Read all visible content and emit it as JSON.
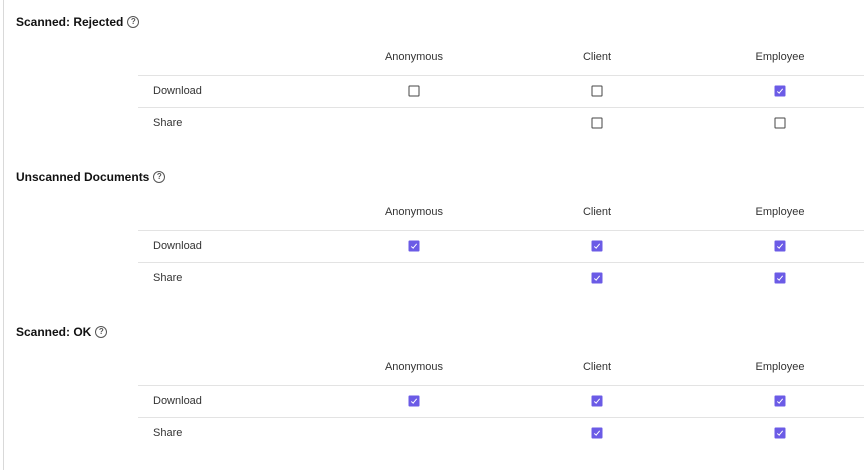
{
  "columns": [
    "Anonymous",
    "Client",
    "Employee"
  ],
  "sections": [
    {
      "title": "Scanned: Rejected",
      "rows": [
        {
          "label": "Download",
          "Anonymous": false,
          "Client": false,
          "Employee": true
        },
        {
          "label": "Share",
          "Anonymous": null,
          "Client": false,
          "Employee": false
        }
      ]
    },
    {
      "title": "Unscanned Documents",
      "rows": [
        {
          "label": "Download",
          "Anonymous": true,
          "Client": true,
          "Employee": true
        },
        {
          "label": "Share",
          "Anonymous": null,
          "Client": true,
          "Employee": true
        }
      ]
    },
    {
      "title": "Scanned: OK",
      "rows": [
        {
          "label": "Download",
          "Anonymous": true,
          "Client": true,
          "Employee": true
        },
        {
          "label": "Share",
          "Anonymous": null,
          "Client": true,
          "Employee": true
        }
      ]
    }
  ],
  "help_icon": "question-circle-icon",
  "accent_color": "#6b5be6"
}
